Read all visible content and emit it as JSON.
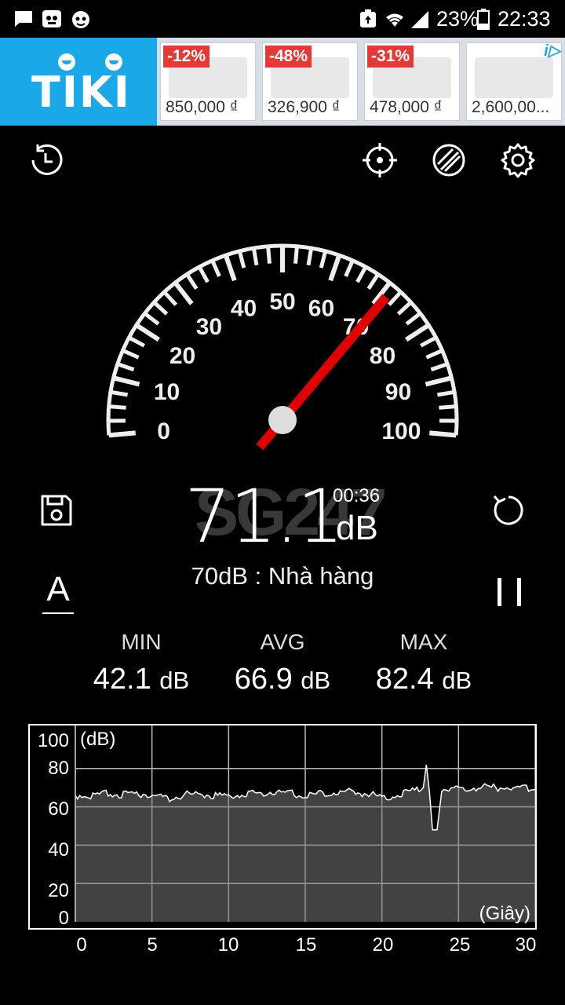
{
  "status_bar": {
    "battery_percent": "23%",
    "time": "22:33"
  },
  "ad": {
    "brand": "TIKI",
    "products": [
      {
        "discount": "-12%",
        "price": "850,000 ₫"
      },
      {
        "discount": "-48%",
        "price": "326,900 ₫"
      },
      {
        "discount": "-31%",
        "price": "478,000 ₫"
      },
      {
        "discount": "",
        "price": "2,600,00..."
      }
    ]
  },
  "toolbar": {
    "icons": [
      "history-icon",
      "crosshair-icon",
      "theme-icon",
      "settings-icon"
    ]
  },
  "gauge": {
    "tick_labels": [
      "0",
      "10",
      "20",
      "30",
      "40",
      "50",
      "60",
      "70",
      "80",
      "90",
      "100"
    ],
    "min": 0,
    "max": 100,
    "needle_value": 71.1
  },
  "reading": {
    "value": "71.1",
    "unit": "dB",
    "elapsed": "00:36",
    "watermark": "SG247",
    "reference": "70dB : Nhà hàng"
  },
  "stats": {
    "min_label": "MIN",
    "min_value": "42.1",
    "avg_label": "AVG",
    "avg_value": "66.9",
    "max_label": "MAX",
    "max_value": "82.4",
    "unit": "dB"
  },
  "controls": {
    "weighting": "A"
  },
  "chart_data": {
    "type": "area",
    "xlabel": "(Giây)",
    "ylabel": "(dB)",
    "xlim": [
      0,
      30
    ],
    "ylim": [
      0,
      100
    ],
    "x_ticks": [
      "0",
      "5",
      "10",
      "15",
      "20",
      "25",
      "30"
    ],
    "y_ticks": [
      "100",
      "80",
      "60",
      "40",
      "20",
      "0"
    ],
    "grid": true,
    "x": [
      0,
      1,
      2,
      3,
      4,
      5,
      6,
      7,
      8,
      9,
      10,
      11,
      12,
      13,
      14,
      15,
      16,
      17,
      18,
      19,
      20,
      21,
      22,
      22.7,
      22.9,
      23.1,
      23.3,
      23.6,
      23.9,
      24.2,
      25,
      26,
      27,
      28,
      29,
      30
    ],
    "values": [
      66,
      66,
      67,
      66,
      67,
      66,
      64,
      66,
      67,
      66,
      66,
      67,
      67,
      68,
      67,
      66,
      67,
      68,
      68,
      67,
      65,
      66,
      68,
      70,
      82,
      68,
      48,
      48,
      68,
      70,
      70,
      70,
      70,
      70,
      70,
      69
    ]
  }
}
